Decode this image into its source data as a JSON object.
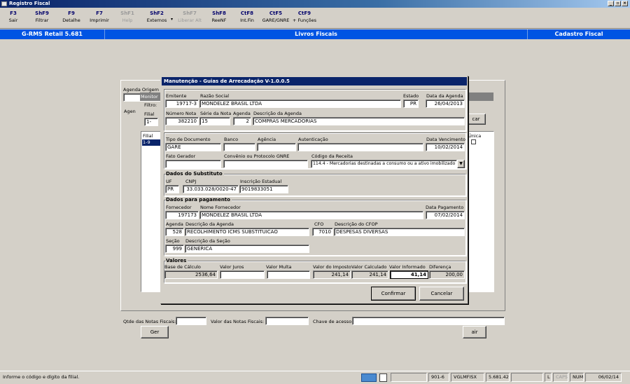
{
  "window": {
    "title": "Registro Fiscal"
  },
  "toolbar": [
    {
      "key": "F3",
      "label": "Sair",
      "enabled": true
    },
    {
      "key": "ShF9",
      "label": "Filtrar",
      "enabled": true
    },
    {
      "key": "F9",
      "label": "Detalhe",
      "enabled": true
    },
    {
      "key": "F7",
      "label": "Imprimir",
      "enabled": true
    },
    {
      "key": "ShF1",
      "label": "Help",
      "enabled": false
    },
    {
      "key": "ShF2",
      "label": "Externos",
      "enabled": true
    },
    {
      "key": "ShF7",
      "label": "Liberar Alt",
      "enabled": false
    },
    {
      "key": "ShF8",
      "label": "ReeNF",
      "enabled": true
    },
    {
      "key": "CtF8",
      "label": "Int.Fin",
      "enabled": true
    },
    {
      "key": "CtF5",
      "label": "GARE/GNRE",
      "enabled": true
    },
    {
      "key": "CtF9",
      "label": "+ Funções",
      "enabled": true
    }
  ],
  "header": {
    "app": "G-RMS Retail 5.681",
    "center": "Livros Fiscais",
    "right": "Cadastro Fiscal"
  },
  "background": {
    "agenda_origem_label": "Agenda Origem",
    "monitor_label": "Monitor",
    "filtro_label": "Filtro:",
    "filial_label": "Filial",
    "filial_value": "1-",
    "agen_label": "Agen",
    "list_filial_header": "Filial",
    "list_row": "1-9",
    "unica_label": "Única",
    "car_button": "car",
    "ger_button": "Ger",
    "air_button": "air",
    "qtde_label": "Qtde das Notas Fiscais:",
    "valor_label": "Valor  das Notas Fiscais:",
    "chave_label": "Chave de acesso:",
    "qtde_value": "",
    "valor_value": "",
    "chave_value": ""
  },
  "dialog": {
    "title": "Manutenção - Guias de Arrecadação V-1.0.0.5",
    "labels": {
      "emitente": "Emitente",
      "razao": "Razão Social",
      "estado": "Estado",
      "data_agenda": "Data da Agenda",
      "numero_nota": "Número Nota",
      "serie": "Série da Nota",
      "agenda": "Agenda",
      "desc_agenda": "Descrição da Agenda",
      "tipo_doc": "Tipo de Documento",
      "banco": "Banco",
      "agencia": "Agência",
      "autenticacao": "Autenticação",
      "data_venc": "Data Vencimento",
      "fato_gerador": "Fato Gerador",
      "convenio": "Convênio ou Protocolo GNRE",
      "cod_receita": "Código da Receita",
      "uf": "UF",
      "cnpj": "CNPJ",
      "insc_estadual": "Inscrição Estadual",
      "fornecedor": "Fornecedor",
      "nome_fornecedor": "Nome Fornecedor",
      "data_pagamento": "Data Pagamento",
      "agenda2": "Agenda",
      "desc_agenda2": "Descrição da Agenda",
      "cfo": "CFO",
      "desc_cfop": "Descrição do CFOP",
      "secao": "Seção",
      "desc_secao": "Descrição da Seção",
      "base_calculo": "Base de Cálculo",
      "valor_juros": "Valor Juros",
      "valor_multa": "Valor Multa",
      "valor_imposto": "Valor do Imposto",
      "valor_calculado": "Valor Calculado",
      "valor_informado": "Valor Informado",
      "diferenca": "Diferença"
    },
    "groups": {
      "substituto": "Dados do Substituto",
      "pagamento": "Dados para pagamento",
      "valores": "Valores"
    },
    "values": {
      "emitente": "19717-3",
      "razao": "MONDELEZ BRASIL LTDA",
      "estado": "PR",
      "data_agenda": "26/04/2013",
      "numero_nota": "382210",
      "serie": "15",
      "agenda": "2",
      "desc_agenda": "COMPRAS MERCADORIAS",
      "tipo_doc": "GARE",
      "banco": "",
      "agencia": "",
      "autenticacao": "",
      "data_venc": "10/02/2014",
      "fato_gerador": "",
      "convenio": "",
      "cod_receita": "114.4 - Mercadorias destinadas a consumo ou a ativo imobilizado",
      "uf": "PR",
      "cnpj": "33.033.028/0020-47",
      "insc_estadual": "9019833051",
      "fornecedor": "197173",
      "nome_fornecedor": "MONDELEZ BRASIL LTDA",
      "data_pagamento": "07/02/2014",
      "agenda2": "528",
      "desc_agenda2": "RECOLHIMENTO ICMS SUBSTITUICAO",
      "cfo": "7010",
      "desc_cfop": "DESPESAS DIVERSAS",
      "secao": "999",
      "desc_secao": "GENERICA",
      "base_calculo": "2536,64",
      "valor_juros": "",
      "valor_multa": "",
      "valor_imposto": "241,14",
      "valor_calculado": "241,14",
      "valor_informado": "41,14",
      "diferenca": "200,00"
    },
    "buttons": {
      "confirmar": "Confirmar",
      "cancelar": "Cancelar"
    }
  },
  "status": {
    "message": "Informe o código e dígito da filial.",
    "code": "901-6",
    "user": "VGLMFISX",
    "version": "5.681.42",
    "l": "L",
    "caps": "CAPS",
    "num": "NUM",
    "date": "06/02/14"
  }
}
